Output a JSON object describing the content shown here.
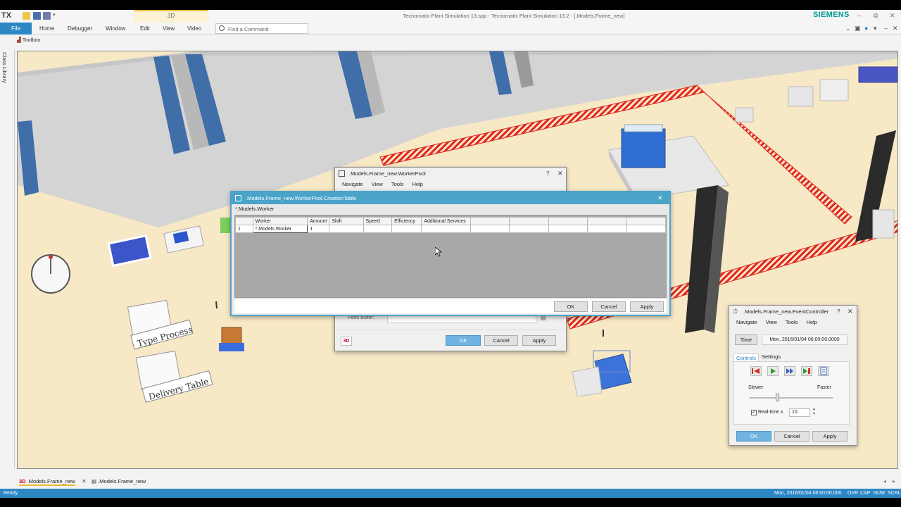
{
  "app": {
    "logo": "TX",
    "context_tab": "3D",
    "window_title": "Tecnomatix Plant Simulation 13.spp - Tecnomatix Plant Simulation 13.2 - [.Models.Frame_new]",
    "brand": "SIEMENS"
  },
  "ribbon": {
    "file": "File",
    "tabs": [
      "Home",
      "Debugger",
      "Window",
      "Edit",
      "View",
      "Video"
    ],
    "find_placeholder": "Find a Command"
  },
  "toolbox": {
    "label": "Toolbox"
  },
  "class_library": {
    "label": "Class Library"
  },
  "scene": {
    "sign1": "Type Process",
    "sign2": "Delivery Table"
  },
  "workerpool": {
    "title": ".Models.Frame_new.WorkerPool",
    "help": "?",
    "menu": [
      "Navigate",
      "View",
      "Tools",
      "Help"
    ],
    "parts_buffer_label": "Parts buffer:",
    "badge_3d": "3D",
    "ok": "OK",
    "cancel": "Cancel",
    "apply": "Apply"
  },
  "creation_table": {
    "title": ".Models.Frame_new.WorkerPool.CreationTable",
    "path": "*.Models.Worker",
    "columns": [
      "Worker",
      "Amount",
      "Shift",
      "Speed",
      "Efficiency",
      "Additional Services",
      "",
      "",
      "",
      "",
      ""
    ],
    "rows": [
      {
        "num": "1",
        "cells": [
          "*.Models.Worker",
          "1",
          "",
          "",
          "",
          "",
          "",
          "",
          "",
          "",
          ""
        ]
      }
    ],
    "ok": "OK",
    "cancel": "Cancel",
    "apply": "Apply"
  },
  "event_controller": {
    "title": ".Models.Frame_new.EventController",
    "help": "?",
    "menu": [
      "Navigate",
      "View",
      "Tools",
      "Help"
    ],
    "time_button": "Time",
    "time_value": "Mon, 2016/01/04 06:00:00.0000",
    "tabs": [
      "Controls",
      "Settings"
    ],
    "slower": "Slower",
    "faster": "Faster",
    "speed_level": 0.33,
    "realtime_label": "Real-time x",
    "realtime_value": "10",
    "ok": "OK",
    "cancel": "Cancel",
    "apply": "Apply"
  },
  "doc_tabs": [
    {
      "badge": "3D",
      "label": ".Models.Frame_new"
    },
    {
      "label": ".Models.Frame_new"
    }
  ],
  "status": {
    "left": "Ready",
    "right": "Mon, 2016/01/04 06:00:00.000",
    "indicators": [
      "OVR",
      "CAP",
      "NUM",
      "SCRL"
    ]
  },
  "colors": {
    "accent": "#2d87c5",
    "dialog_title": "#4aa3c9",
    "floor": "#f7e8c6",
    "wall_blue": "#3f6ea8",
    "fence_red": "#e0261f",
    "brand": "#009999"
  }
}
